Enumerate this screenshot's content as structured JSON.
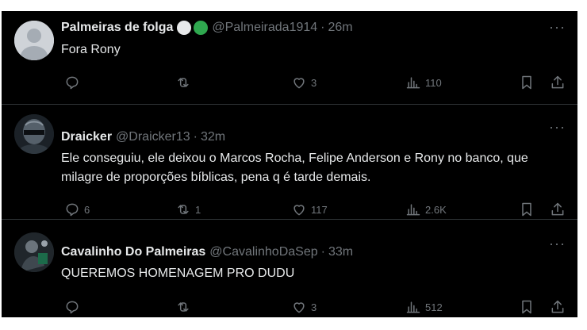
{
  "tweets": [
    {
      "name": "Palmeiras de folga",
      "handle": "@Palmeirada1914",
      "sep": "·",
      "time": "26m",
      "text": "Fora Rony",
      "replies": "",
      "retweets": "",
      "likes": "3",
      "views": "110",
      "badges": [
        "#e7e9ea",
        "#2fa84f"
      ]
    },
    {
      "name": "Draicker",
      "handle": "@Draicker13",
      "sep": "·",
      "time": "32m",
      "text": "Ele conseguiu, ele deixou o Marcos Rocha, Felipe Anderson e Rony no banco, que milagre de proporções bíblicas, pena q é tarde demais.",
      "replies": "6",
      "retweets": "1",
      "likes": "117",
      "views": "2.6K"
    },
    {
      "name": "Cavalinho Do Palmeiras",
      "handle": "@CavalinhoDaSep",
      "sep": "·",
      "time": "33m",
      "text": "QUEREMOS HOMENAGEM PRO DUDU",
      "replies": "",
      "retweets": "",
      "likes": "3",
      "views": "512"
    }
  ],
  "more_glyph": "···",
  "colors": {
    "background": "#000000",
    "text": "#e7e9ea",
    "muted": "#71767b",
    "divider": "#2f3336"
  }
}
